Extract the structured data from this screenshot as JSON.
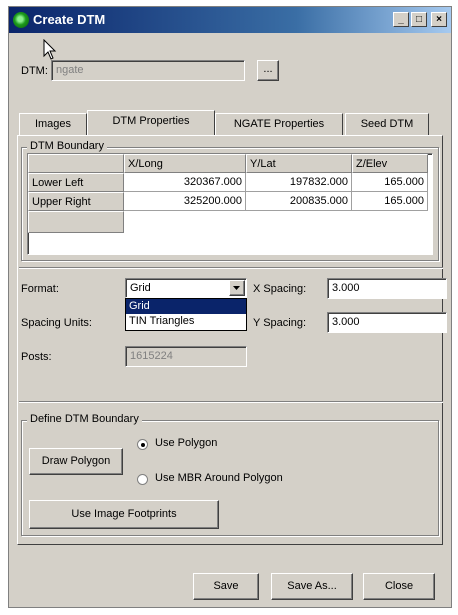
{
  "window": {
    "title": "Create DTM",
    "minimize_glyph": "_",
    "maximize_glyph": "□",
    "close_glyph": "×"
  },
  "dtm": {
    "label": "DTM:",
    "value": "ngate",
    "browse_label": "..."
  },
  "tabs": [
    {
      "label": "Images"
    },
    {
      "label": "DTM Properties"
    },
    {
      "label": "NGATE Properties"
    },
    {
      "label": "Seed DTM"
    }
  ],
  "boundary": {
    "group_title": "DTM Boundary",
    "columns": [
      "",
      "X/Long",
      "Y/Lat",
      "Z/Elev"
    ],
    "rows": [
      {
        "label": "Lower Left",
        "x": "320367.000",
        "y": "197832.000",
        "z": "165.000"
      },
      {
        "label": "Upper Right",
        "x": "325200.000",
        "y": "200835.000",
        "z": "165.000"
      }
    ]
  },
  "format": {
    "label": "Format:",
    "value": "Grid",
    "options": [
      "Grid",
      "TIN Triangles"
    ],
    "highlighted": "Grid"
  },
  "spacing_units": {
    "label": "Spacing Units:"
  },
  "x_spacing": {
    "label": "X Spacing:",
    "value": "3.000"
  },
  "y_spacing": {
    "label": "Y Spacing:",
    "value": "3.000"
  },
  "posts": {
    "label": "Posts:",
    "value": "1615224"
  },
  "define_boundary": {
    "group_title": "Define DTM Boundary",
    "draw_polygon_label": "Draw Polygon",
    "use_polygon_label": "Use Polygon",
    "use_mbr_label": "Use MBR Around Polygon",
    "use_image_footprints_label": "Use Image Footprints",
    "selected": "Use Polygon"
  },
  "footer": {
    "save_label": "Save",
    "save_as_label": "Save As...",
    "close_label": "Close"
  }
}
